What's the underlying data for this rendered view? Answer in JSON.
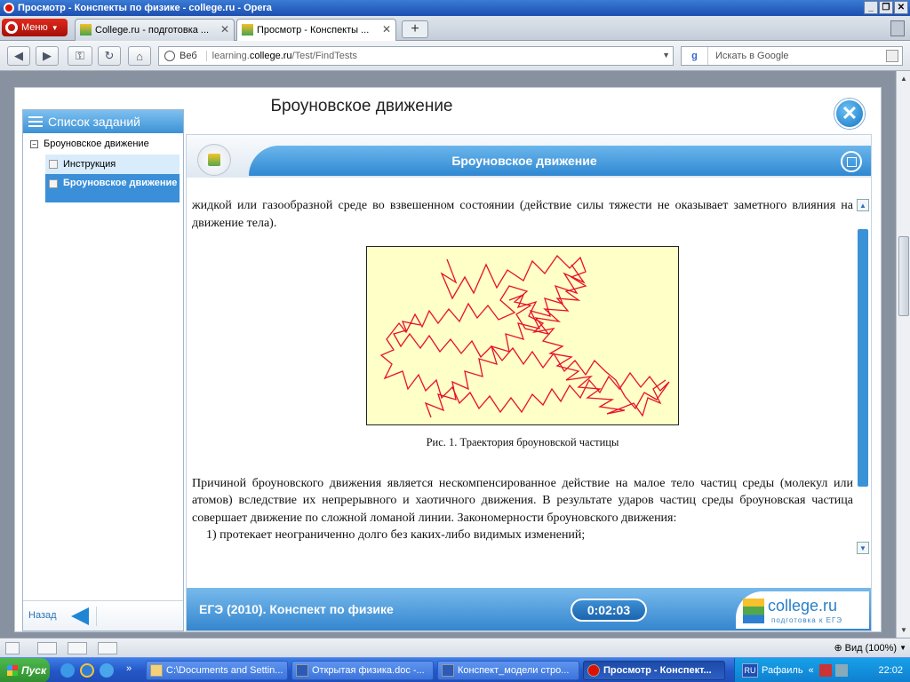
{
  "window": {
    "title": "Просмотр - Конспекты по физике - college.ru - Opera"
  },
  "browser": {
    "menu_label": "Меню",
    "tabs": [
      {
        "label": "College.ru - подготовка ..."
      },
      {
        "label": "Просмотр - Конспекты ..."
      }
    ],
    "address": {
      "prefix": "Веб",
      "host_pre": "learning.",
      "host_bold": "college.ru",
      "path": "/Test/FindTests"
    },
    "search_placeholder": "Искать в Google",
    "status_zoom": "Вид (100%)"
  },
  "app": {
    "header_title": "Броуновское движение",
    "sidebar": {
      "title": "Список заданий",
      "root": "Броуновское движение",
      "items": [
        {
          "label": "Инструкция",
          "selected": false
        },
        {
          "label": "Броуновское движение",
          "selected": true
        }
      ],
      "back_label": "Назад"
    },
    "panel": {
      "title": "Броуновское движение",
      "intro": "жидкой или газообразной среде во взвешенном состоянии (действие силы тяжести не оказывает заметного влияния на движение тела).",
      "caption": "Рис. 1. Траектория броуновской частицы",
      "paragraph": "Причиной броуновского движения является нескомпенсированное действие на малое тело частиц среды (молекул или атомов) вследствие их непрерывного и хаотичного движения. В результате ударов частиц среды броуновская частица совершает движение по сложной ломаной линии. Закономерности броуновского движения:",
      "list_item": "1)    протекает неограниченно долго без каких-либо видимых изменений;"
    },
    "footer": {
      "title": "ЕГЭ (2010). Конспект по физике",
      "timer": "0:02:03",
      "logo_text": "college.ru",
      "logo_sub": "подготовка к ЕГЭ"
    }
  },
  "taskbar": {
    "start": "Пуск",
    "tasks": [
      {
        "label": "C:\\Documents and Settin..."
      },
      {
        "label": "Открытая физика.doc -..."
      },
      {
        "label": "Конспект_модели стро..."
      },
      {
        "label": "Просмотр - Конспект..."
      }
    ],
    "lang": "RU",
    "user": "Рафаиль",
    "clock": "22:02"
  },
  "colors": {
    "accent": "#3a8fd8",
    "trajectory": "#e8102a",
    "figure_bg": "#ffffc8"
  }
}
